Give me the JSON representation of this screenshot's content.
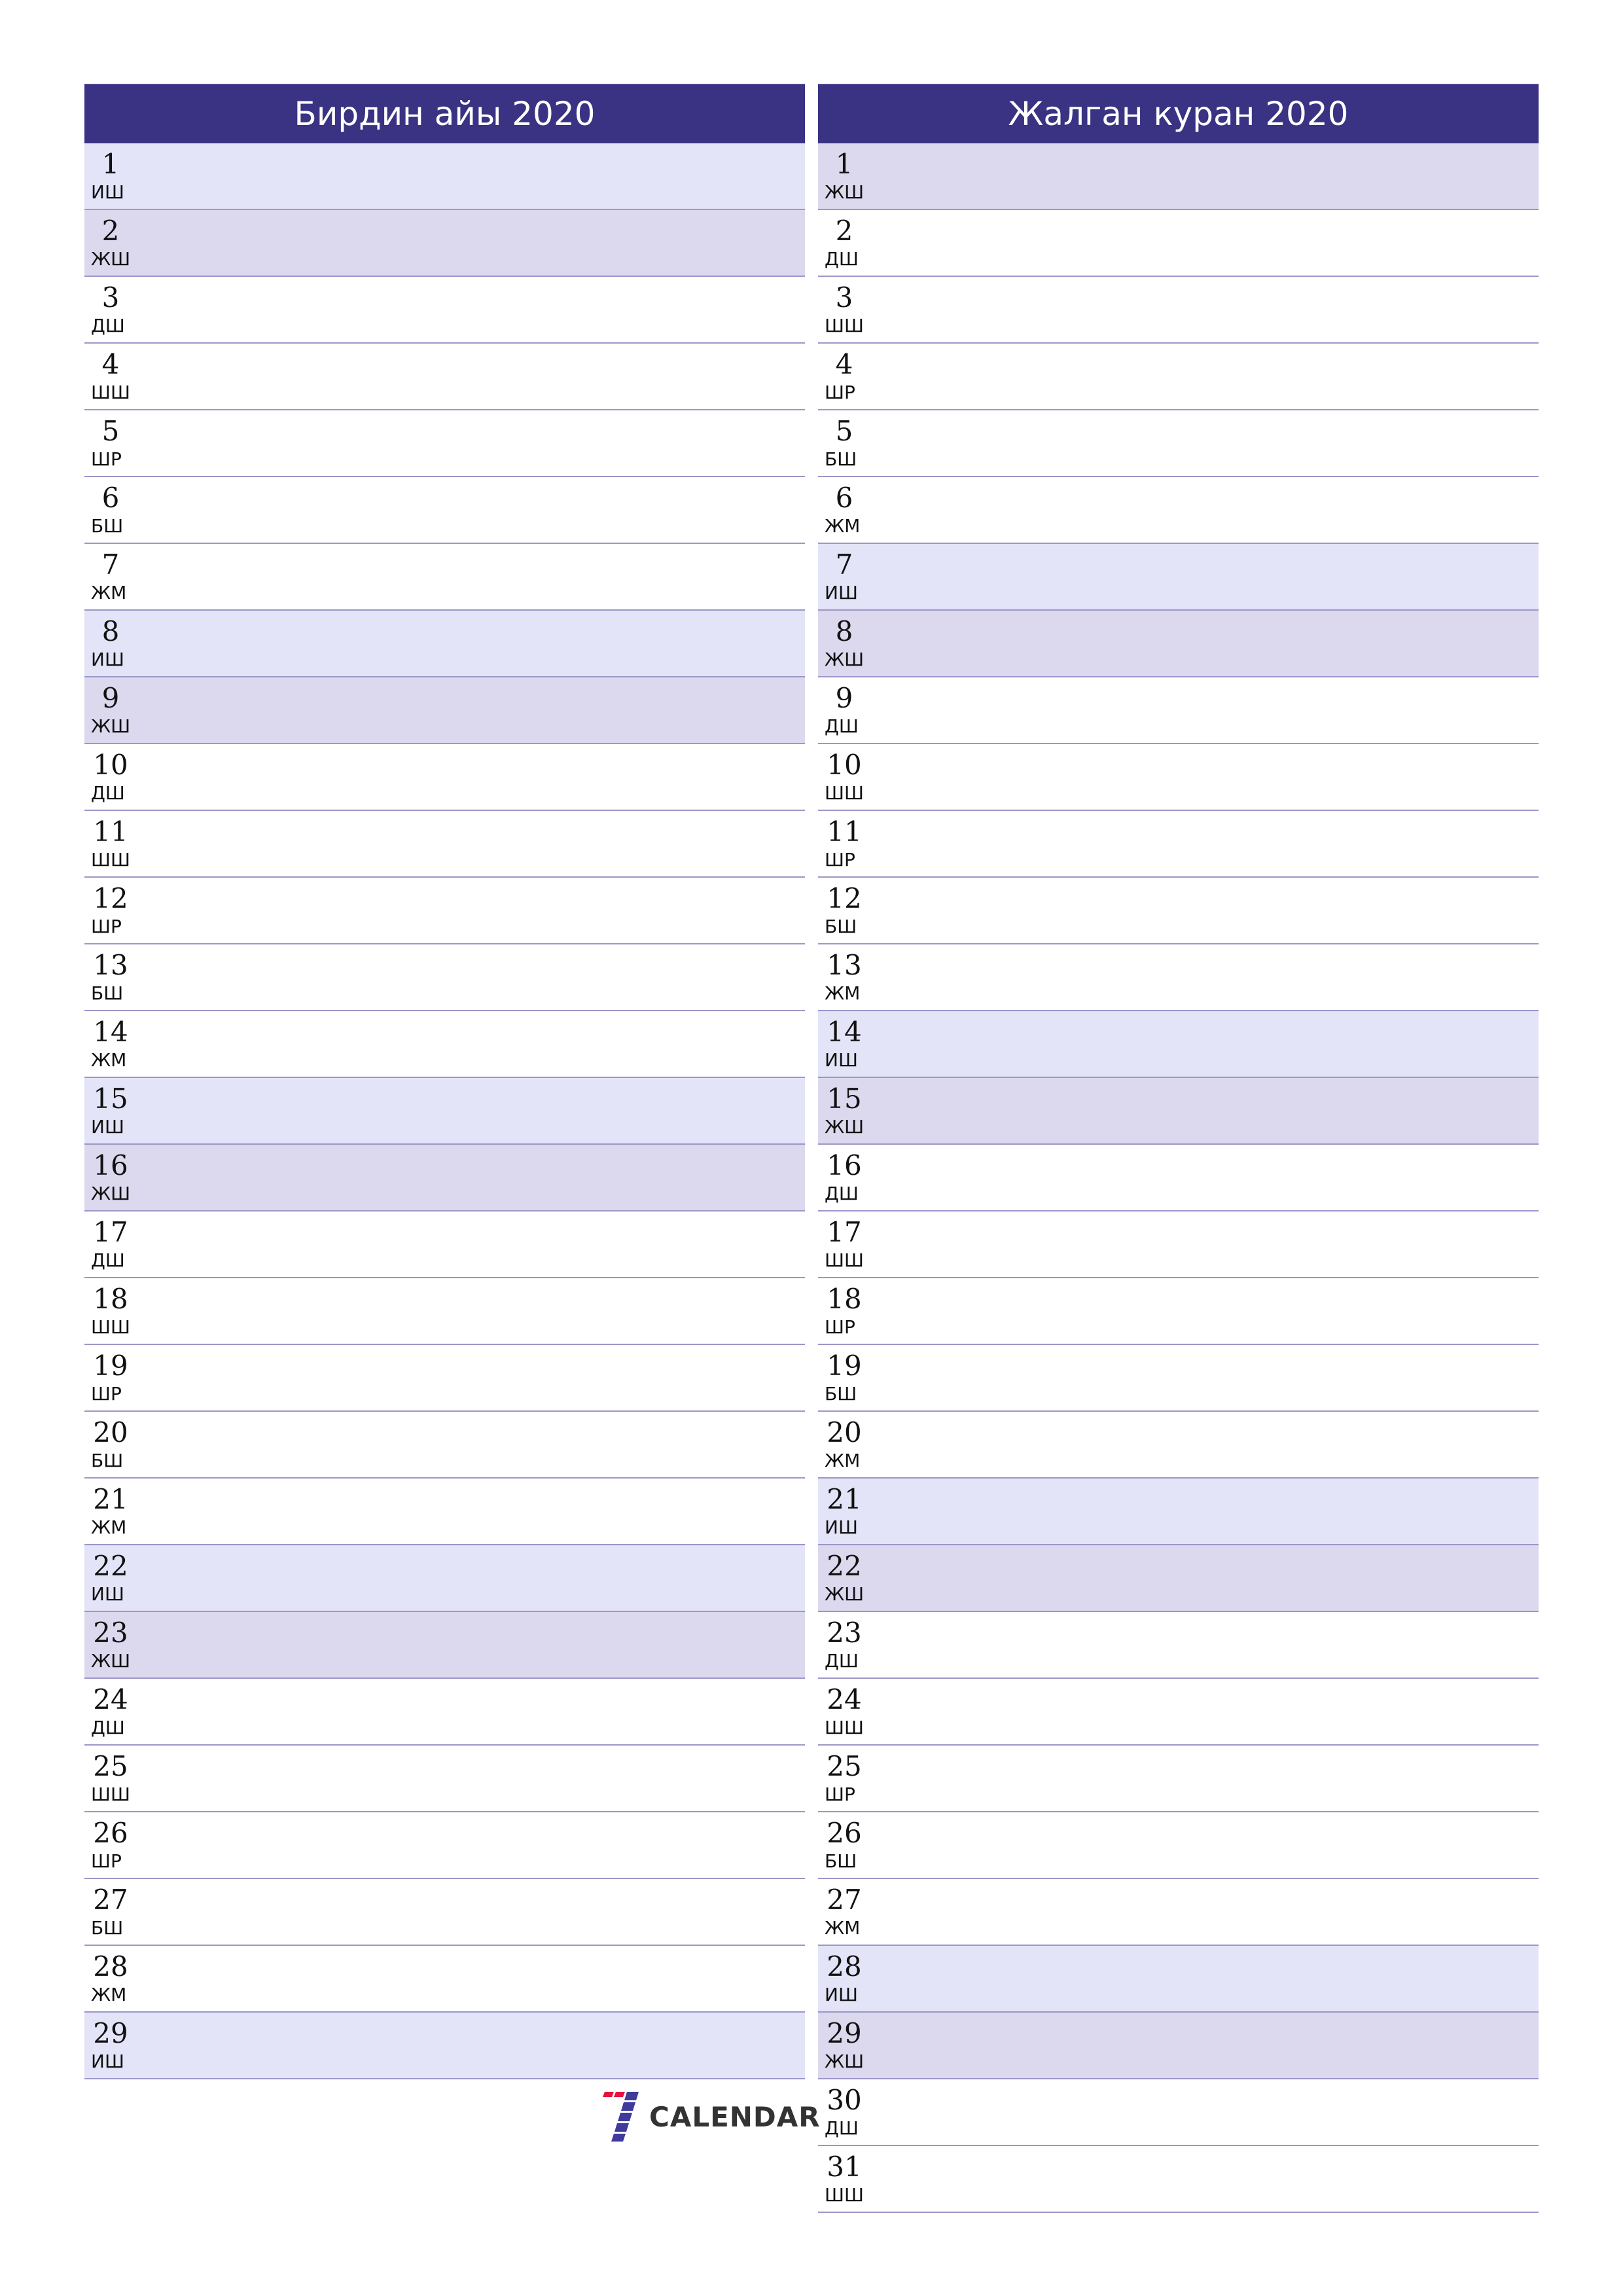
{
  "colors": {
    "header_bg": "#3a3282",
    "saturday_row": "#e4e4f8",
    "sunday_row": "#dcd8ee",
    "row_border": "#9b97c8",
    "logo_red": "#e8103f",
    "logo_blue": "#3f3a9c"
  },
  "months": [
    {
      "title": "Бирдин айы 2020",
      "days": [
        {
          "num": "1",
          "wd": "ИШ",
          "type": "sat"
        },
        {
          "num": "2",
          "wd": "ЖШ",
          "type": "sun"
        },
        {
          "num": "3",
          "wd": "ДШ",
          "type": "wk"
        },
        {
          "num": "4",
          "wd": "ШШ",
          "type": "wk"
        },
        {
          "num": "5",
          "wd": "ШР",
          "type": "wk"
        },
        {
          "num": "6",
          "wd": "БШ",
          "type": "wk"
        },
        {
          "num": "7",
          "wd": "ЖМ",
          "type": "wk"
        },
        {
          "num": "8",
          "wd": "ИШ",
          "type": "sat"
        },
        {
          "num": "9",
          "wd": "ЖШ",
          "type": "sun"
        },
        {
          "num": "10",
          "wd": "ДШ",
          "type": "wk"
        },
        {
          "num": "11",
          "wd": "ШШ",
          "type": "wk"
        },
        {
          "num": "12",
          "wd": "ШР",
          "type": "wk"
        },
        {
          "num": "13",
          "wd": "БШ",
          "type": "wk"
        },
        {
          "num": "14",
          "wd": "ЖМ",
          "type": "wk"
        },
        {
          "num": "15",
          "wd": "ИШ",
          "type": "sat"
        },
        {
          "num": "16",
          "wd": "ЖШ",
          "type": "sun"
        },
        {
          "num": "17",
          "wd": "ДШ",
          "type": "wk"
        },
        {
          "num": "18",
          "wd": "ШШ",
          "type": "wk"
        },
        {
          "num": "19",
          "wd": "ШР",
          "type": "wk"
        },
        {
          "num": "20",
          "wd": "БШ",
          "type": "wk"
        },
        {
          "num": "21",
          "wd": "ЖМ",
          "type": "wk"
        },
        {
          "num": "22",
          "wd": "ИШ",
          "type": "sat"
        },
        {
          "num": "23",
          "wd": "ЖШ",
          "type": "sun"
        },
        {
          "num": "24",
          "wd": "ДШ",
          "type": "wk"
        },
        {
          "num": "25",
          "wd": "ШШ",
          "type": "wk"
        },
        {
          "num": "26",
          "wd": "ШР",
          "type": "wk"
        },
        {
          "num": "27",
          "wd": "БШ",
          "type": "wk"
        },
        {
          "num": "28",
          "wd": "ЖМ",
          "type": "wk"
        },
        {
          "num": "29",
          "wd": "ИШ",
          "type": "sat"
        }
      ]
    },
    {
      "title": "Жалган куран 2020",
      "days": [
        {
          "num": "1",
          "wd": "ЖШ",
          "type": "sun"
        },
        {
          "num": "2",
          "wd": "ДШ",
          "type": "wk"
        },
        {
          "num": "3",
          "wd": "ШШ",
          "type": "wk"
        },
        {
          "num": "4",
          "wd": "ШР",
          "type": "wk"
        },
        {
          "num": "5",
          "wd": "БШ",
          "type": "wk"
        },
        {
          "num": "6",
          "wd": "ЖМ",
          "type": "wk"
        },
        {
          "num": "7",
          "wd": "ИШ",
          "type": "sat"
        },
        {
          "num": "8",
          "wd": "ЖШ",
          "type": "sun"
        },
        {
          "num": "9",
          "wd": "ДШ",
          "type": "wk"
        },
        {
          "num": "10",
          "wd": "ШШ",
          "type": "wk"
        },
        {
          "num": "11",
          "wd": "ШР",
          "type": "wk"
        },
        {
          "num": "12",
          "wd": "БШ",
          "type": "wk"
        },
        {
          "num": "13",
          "wd": "ЖМ",
          "type": "wk"
        },
        {
          "num": "14",
          "wd": "ИШ",
          "type": "sat"
        },
        {
          "num": "15",
          "wd": "ЖШ",
          "type": "sun"
        },
        {
          "num": "16",
          "wd": "ДШ",
          "type": "wk"
        },
        {
          "num": "17",
          "wd": "ШШ",
          "type": "wk"
        },
        {
          "num": "18",
          "wd": "ШР",
          "type": "wk"
        },
        {
          "num": "19",
          "wd": "БШ",
          "type": "wk"
        },
        {
          "num": "20",
          "wd": "ЖМ",
          "type": "wk"
        },
        {
          "num": "21",
          "wd": "ИШ",
          "type": "sat"
        },
        {
          "num": "22",
          "wd": "ЖШ",
          "type": "sun"
        },
        {
          "num": "23",
          "wd": "ДШ",
          "type": "wk"
        },
        {
          "num": "24",
          "wd": "ШШ",
          "type": "wk"
        },
        {
          "num": "25",
          "wd": "ШР",
          "type": "wk"
        },
        {
          "num": "26",
          "wd": "БШ",
          "type": "wk"
        },
        {
          "num": "27",
          "wd": "ЖМ",
          "type": "wk"
        },
        {
          "num": "28",
          "wd": "ИШ",
          "type": "sat"
        },
        {
          "num": "29",
          "wd": "ЖШ",
          "type": "sun"
        },
        {
          "num": "30",
          "wd": "ДШ",
          "type": "wk"
        },
        {
          "num": "31",
          "wd": "ШШ",
          "type": "wk"
        }
      ]
    }
  ],
  "logo": {
    "icon": "seven-icon",
    "text": "CALENDAR"
  }
}
